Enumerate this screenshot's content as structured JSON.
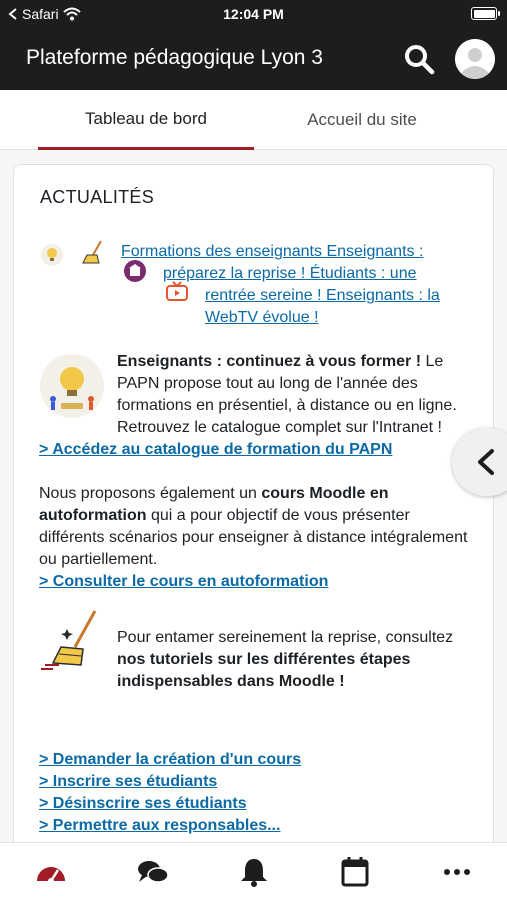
{
  "status_bar": {
    "carrier": "Safari",
    "time": "12:04 PM"
  },
  "header": {
    "title": "Plateforme pédagogique Lyon 3",
    "search_icon": "search-icon",
    "avatar_icon": "user-avatar-icon"
  },
  "tabs": [
    {
      "label": "Tableau de bord",
      "active": true
    },
    {
      "label": "Accueil du site",
      "active": false
    }
  ],
  "card": {
    "title": "ACTUALITÉS",
    "news_links": [
      "Formations des enseignants",
      "Enseignants :",
      "préparez la reprise !",
      "Étudiants : une",
      "rentrée sereine !",
      "Enseignants : la",
      "WebTV évolue !"
    ],
    "section1": {
      "heading": "Enseignants : continuez à vous former !",
      "body": "Le PAPN propose tout au long de l'année des formations en présentiel, à distance ou en ligne. Retrouvez le catalogue complet sur l'Intranet !",
      "link": "> Accédez au catalogue de formation du PAPN"
    },
    "section2": {
      "before": "Nous proposons également un ",
      "bold": "cours Moodle en autoformation",
      "after": " qui a pour objectif de vous présenter différents scénarios pour enseigner à distance intégralement ou partiellement.",
      "link": "> Consulter le cours en autoformation"
    },
    "section3": {
      "before": "Pour entamer sereinement la reprise, consultez ",
      "bold": "nos tutoriels sur les différentes étapes indispensables dans Moodle !"
    },
    "links": [
      "> Demander la création d'un cours",
      "> Inscrire ses étudiants",
      "> Désinscrire ses étudiants",
      "> Permettre aux responsables..."
    ]
  },
  "bottom_nav": [
    {
      "name": "dashboard-icon",
      "active": true
    },
    {
      "name": "messages-icon",
      "active": false
    },
    {
      "name": "notifications-icon",
      "active": false
    },
    {
      "name": "calendar-icon",
      "active": false
    },
    {
      "name": "more-icon",
      "active": false
    }
  ],
  "colors": {
    "bar": "#1d1d1d",
    "accent": "#a11d26",
    "link": "#0b6aa5"
  }
}
